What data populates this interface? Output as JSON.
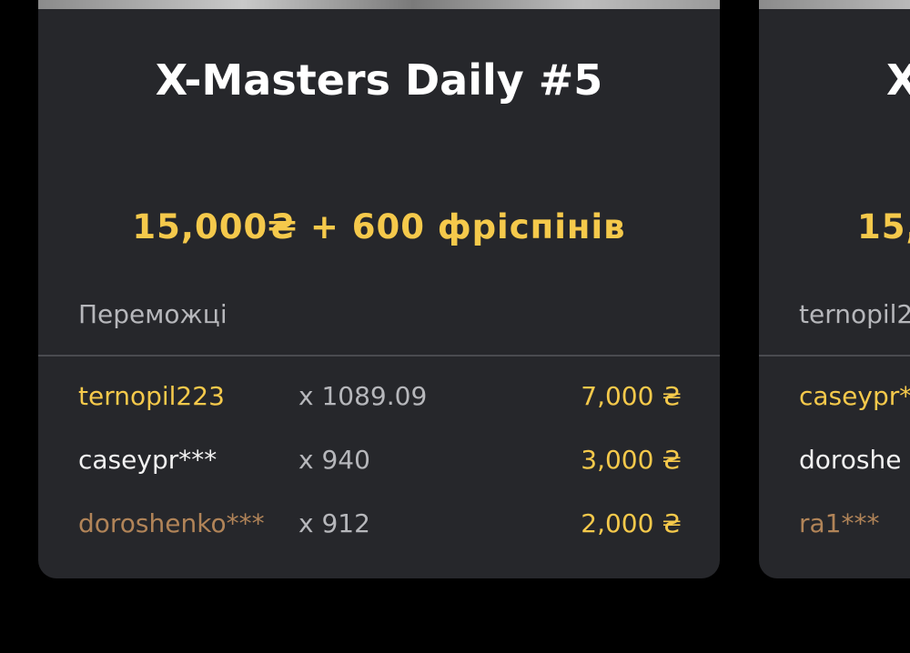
{
  "cards": [
    {
      "title": "X-Masters Daily #5",
      "prize": "15,000₴ + 600 фріспінів",
      "winners_header": "Переможці",
      "winners": [
        {
          "name": "ternopil223",
          "multiplier": "x 1089.09",
          "amount": "7,000 ₴"
        },
        {
          "name": "caseypr***",
          "multiplier": "x 940",
          "amount": "3,000 ₴"
        },
        {
          "name": "doroshenko***",
          "multiplier": "x 912",
          "amount": "2,000 ₴"
        }
      ]
    },
    {
      "title": "X",
      "prize": "15,",
      "winners_header": "ternopil2",
      "winners": [
        {
          "name": "caseypr*"
        },
        {
          "name": "doroshe"
        },
        {
          "name": "ra1***"
        }
      ]
    }
  ],
  "colors": {
    "background": "#000000",
    "card": "#26272b",
    "accent_gold": "#f5c94b",
    "text_white": "#f2f2f2",
    "text_muted": "#b6b7bb",
    "bronze": "#b18458"
  }
}
